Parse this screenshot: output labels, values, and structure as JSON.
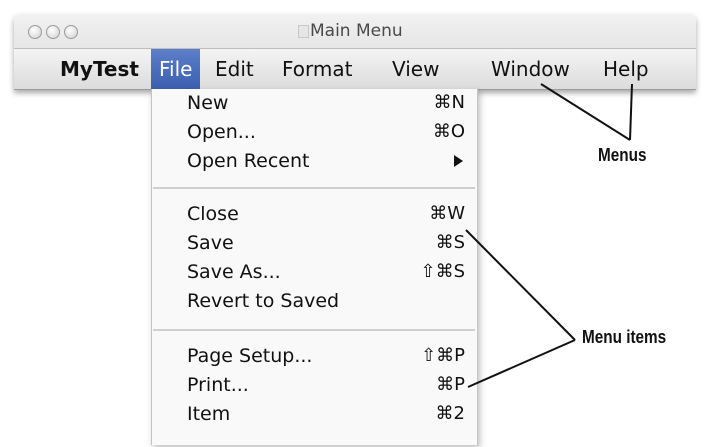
{
  "window": {
    "title": "Main Menu"
  },
  "menubar": {
    "items": [
      {
        "label": "MyTest"
      },
      {
        "label": "File"
      },
      {
        "label": "Edit"
      },
      {
        "label": "Format"
      },
      {
        "label": "View"
      },
      {
        "label": "Window"
      },
      {
        "label": "Help"
      }
    ],
    "active": "File"
  },
  "file_menu": {
    "items": [
      {
        "label": "New",
        "shortcut": "⌘N"
      },
      {
        "label": "Open...",
        "shortcut": "⌘O"
      },
      {
        "label": "Open Recent",
        "submenu_icon": "triangle-right-icon"
      },
      {
        "label": "Close",
        "shortcut": "⌘W"
      },
      {
        "label": "Save",
        "shortcut": "⌘S"
      },
      {
        "label": "Save As...",
        "shortcut": "⇧⌘S"
      },
      {
        "label": "Revert to Saved"
      },
      {
        "label": "Page Setup...",
        "shortcut": "⇧⌘P"
      },
      {
        "label": "Print...",
        "shortcut": "⌘P"
      },
      {
        "label": "Item",
        "shortcut": "⌘2"
      }
    ]
  },
  "annotations": {
    "menus_label": "Menus",
    "menu_items_label": "Menu items"
  },
  "colors": {
    "highlight": "#3b5fb0",
    "text": "#111111"
  }
}
